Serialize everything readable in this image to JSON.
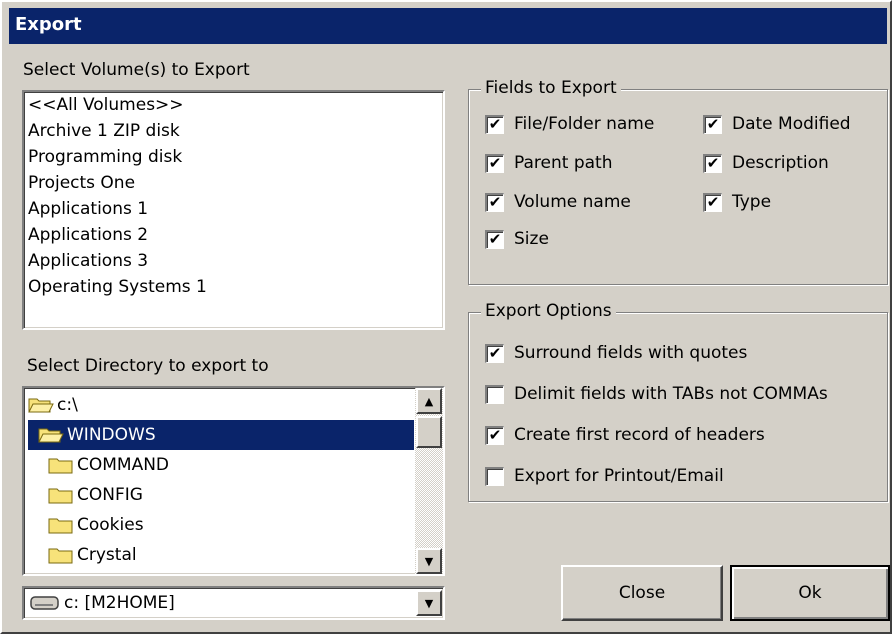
{
  "window": {
    "title": "Export"
  },
  "volumes": {
    "label": "Select Volume(s) to Export",
    "items": [
      "<<All Volumes>>",
      "Archive 1 ZIP disk",
      "Programming disk",
      "Projects One",
      "Applications 1",
      "Applications 2",
      "Applications 3",
      "Operating Systems 1"
    ]
  },
  "directory": {
    "label": "Select Directory to export to",
    "items": [
      {
        "name": "c:\\",
        "icon": "open-folder-icon"
      },
      {
        "name": "WINDOWS",
        "icon": "open-folder-icon",
        "selected": true
      },
      {
        "name": "COMMAND",
        "icon": "folder-icon"
      },
      {
        "name": "CONFIG",
        "icon": "folder-icon"
      },
      {
        "name": "Cookies",
        "icon": "folder-icon"
      },
      {
        "name": "Crystal",
        "icon": "folder-icon"
      }
    ],
    "drive": {
      "value": "c: [M2HOME]",
      "icon": "drive-icon"
    }
  },
  "fields": {
    "legend": "Fields to Export",
    "items": [
      {
        "label": "File/Folder name",
        "checked": true
      },
      {
        "label": "Parent path",
        "checked": true
      },
      {
        "label": "Volume name",
        "checked": true
      },
      {
        "label": "Size",
        "checked": true
      },
      {
        "label": "Date Modified",
        "checked": true
      },
      {
        "label": "Description",
        "checked": true
      },
      {
        "label": "Type",
        "checked": true
      }
    ]
  },
  "options": {
    "legend": "Export Options",
    "items": [
      {
        "label": "Surround fields with quotes",
        "checked": true
      },
      {
        "label": "Delimit fields with TABs not COMMAs",
        "checked": false
      },
      {
        "label": "Create first record of headers",
        "checked": true
      },
      {
        "label": "Export for Printout/Email",
        "checked": false
      }
    ]
  },
  "buttons": {
    "close": "Close",
    "ok": "Ok"
  },
  "colors": {
    "face": "#d4d0c8",
    "title_bar": "#0a246a",
    "selection": "#0a246a"
  }
}
